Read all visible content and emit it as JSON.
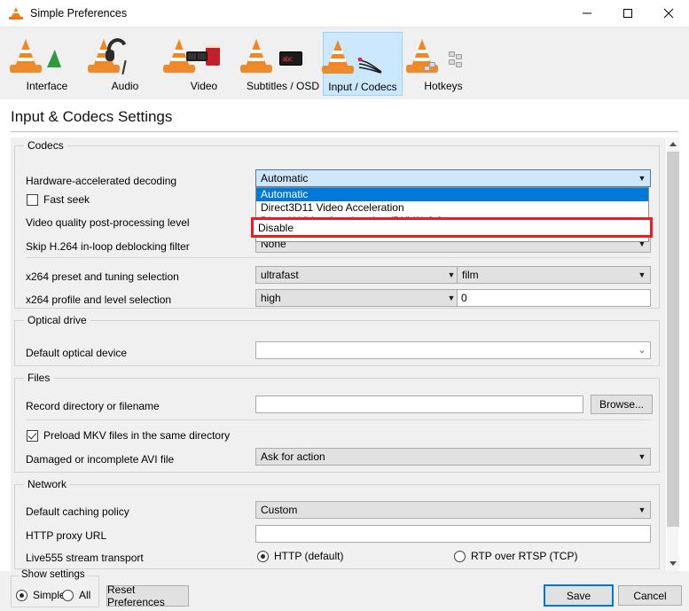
{
  "window": {
    "title": "Simple Preferences",
    "app_icon": "vlc-cone-icon",
    "minimize_label": "–",
    "maximize_label": "□",
    "close_label": "✕"
  },
  "toolbar": {
    "items": [
      {
        "label": "Interface",
        "icon": "vlc-cone-interface-icon",
        "selected": false
      },
      {
        "label": "Audio",
        "icon": "vlc-cone-headphones-icon",
        "selected": false
      },
      {
        "label": "Video",
        "icon": "vlc-cone-3dglasses-popcorn-icon",
        "selected": false
      },
      {
        "label": "Subtitles / OSD",
        "icon": "vlc-cone-display-icon",
        "selected": false
      },
      {
        "label": "Input / Codecs",
        "icon": "vlc-cone-cables-icon",
        "selected": true
      },
      {
        "label": "Hotkeys",
        "icon": "vlc-cone-keyboard-icon",
        "selected": false
      }
    ]
  },
  "page": {
    "title": "Input & Codecs Settings"
  },
  "sections": {
    "codecs": {
      "title": "Codecs",
      "hw_decoding_label": "Hardware-accelerated decoding",
      "hw_decoding_value": "Automatic",
      "fast_seek_label": "Fast seek",
      "fast_seek_checked": false,
      "video_quality_label": "Video quality post-processing level",
      "skip_h264_label": "Skip H.264 in-loop deblocking filter",
      "skip_h264_value": "None",
      "x264_preset_label": "x264 preset and tuning selection",
      "x264_preset_value": "ultrafast",
      "x264_tuning_value": "film",
      "x264_profile_label": "x264 profile and level selection",
      "x264_profile_value": "high",
      "x264_level_value": "0"
    },
    "optical": {
      "title": "Optical drive",
      "default_device_label": "Default optical device",
      "default_device_value": ""
    },
    "files": {
      "title": "Files",
      "record_dir_label": "Record directory or filename",
      "record_dir_value": "",
      "browse_label": "Browse...",
      "preload_mkv_label": "Preload MKV files in the same directory",
      "preload_mkv_checked": true,
      "avi_label": "Damaged or incomplete AVI file",
      "avi_value": "Ask for action"
    },
    "network": {
      "title": "Network",
      "caching_label": "Default caching policy",
      "caching_value": "Custom",
      "proxy_label": "HTTP proxy URL",
      "proxy_value": "",
      "live555_label": "Live555 stream transport",
      "live555_http_label": "HTTP (default)",
      "live555_http_selected": true,
      "live555_rtp_label": "RTP over RTSP (TCP)",
      "live555_rtp_selected": false
    }
  },
  "dropdown": {
    "open": true,
    "owner": "hardware-accelerated-decoding",
    "options": [
      "Automatic",
      "Direct3D11 Video Acceleration",
      "DirectX Video Acceleration (DXVA) 2.0",
      "Disable"
    ],
    "selected_index": 0,
    "highlighted_option": "Disable",
    "highlight_color": "#ee1b24",
    "selection_color": "#0078d7"
  },
  "scrollbar": {
    "up_arrow": "▲",
    "down_arrow": "▼"
  },
  "footer": {
    "show_settings_title": "Show settings",
    "simple_label": "Simple",
    "simple_selected": true,
    "all_label": "All",
    "all_selected": false,
    "reset_label": "Reset Preferences",
    "save_label": "Save",
    "cancel_label": "Cancel"
  },
  "glyphs": {
    "combo_arrow": "▼",
    "combo_chevron": "⌄"
  }
}
